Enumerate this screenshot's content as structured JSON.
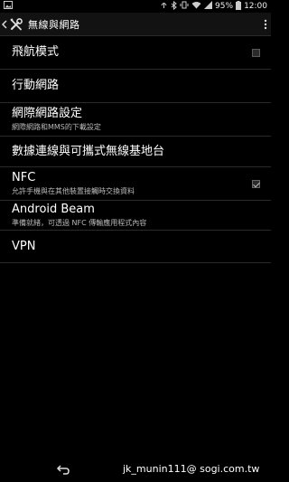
{
  "status_bar": {
    "battery_percent": "95%",
    "time": "12:00",
    "icons": [
      "image-icon",
      "signal-icon",
      "bluetooth-icon",
      "vibrate-icon",
      "wifi-icon",
      "mobile-signal-icon",
      "battery-icon"
    ]
  },
  "action_bar": {
    "title": "無線與網路",
    "icon": "tools-icon"
  },
  "settings": [
    {
      "label": "飛航模式",
      "control": "checkbox",
      "checked": false
    },
    {
      "label": "行動網路"
    },
    {
      "label": "網際網路設定",
      "sub": "網際網路和MMS的下載設定"
    },
    {
      "label": "數據連線與可攜式無線基地台"
    },
    {
      "label": "NFC",
      "sub": "允許手機與在其他裝置接觸時交換資料",
      "control": "checkbox",
      "checked": true
    },
    {
      "label": "Android Beam",
      "sub": "準備就緒，可透過 NFC 傳輸應用程式內容"
    },
    {
      "label": "VPN"
    }
  ],
  "nav_bar": {
    "watermark": "jk_munin111@ sogi.com.tw"
  }
}
